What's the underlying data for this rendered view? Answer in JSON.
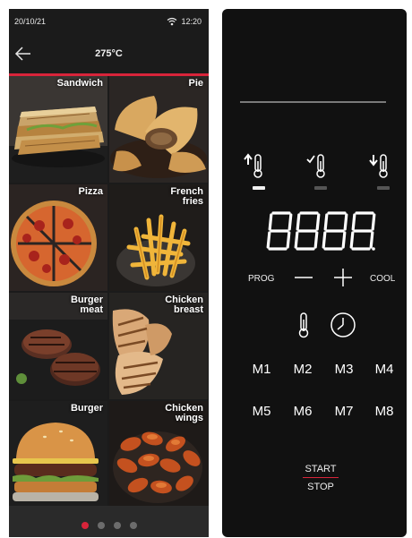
{
  "status_bar": {
    "date": "20/10/21",
    "time": "12:20"
  },
  "app_bar": {
    "title": "275°C"
  },
  "menu_items": [
    {
      "label": "Sandwich"
    },
    {
      "label": "Pie"
    },
    {
      "label": "Pizza"
    },
    {
      "label": "French\nfries"
    },
    {
      "label": "Burger\nmeat"
    },
    {
      "label": "Chicken\nbreast"
    },
    {
      "label": "Burger"
    },
    {
      "label": "Chicken\nwings"
    }
  ],
  "pager": {
    "pages": 4,
    "active_page": 1
  },
  "colors": {
    "accent": "#d8243a",
    "phone_bg": "#1b1b1b",
    "panel_bg": "#111111"
  },
  "control_panel": {
    "temperature_indicators": [
      "temp-up-indicator",
      "temp-ok-indicator",
      "temp-down-indicator"
    ],
    "display": "8888",
    "prog_label": "PROG",
    "cool_label": "COOL",
    "memory_keys": [
      "M1",
      "M2",
      "M3",
      "M4",
      "M5",
      "M6",
      "M7",
      "M8"
    ],
    "start_label": "START",
    "stop_label": "STOP"
  }
}
